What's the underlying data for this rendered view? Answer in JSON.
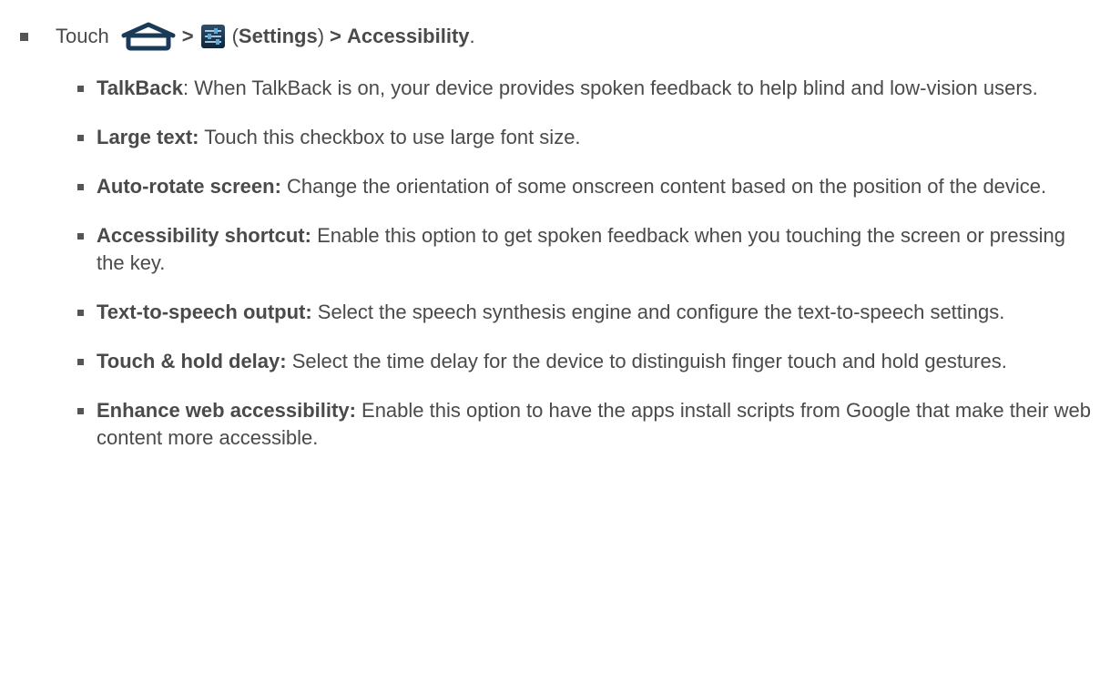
{
  "step": {
    "touch": "Touch",
    "gt1": ">",
    "paren_open": "(",
    "settings": "Settings",
    "paren_close": ")",
    "gt2": "> ",
    "accessibility": "Accessibility",
    "period": ".",
    "icons": [
      "home-icon",
      "settings-icon"
    ]
  },
  "items": [
    {
      "term": "TalkBack",
      "desc": ": When TalkBack is on, your device provides spoken feedback to help blind and low-vision users."
    },
    {
      "term": "Large text:",
      "desc": " Touch this checkbox to use large font size."
    },
    {
      "term": "Auto-rotate screen:",
      "desc": " Change the orientation of some onscreen content based on the position of the device."
    },
    {
      "term": "Accessibility shortcut:",
      "desc": " Enable this option to get spoken feedback when you touching the screen or pressing the key."
    },
    {
      "term": "Text-to-speech output:",
      "desc": " Select the speech synthesis engine and configure the text-to-speech settings."
    },
    {
      "term": "Touch & hold delay:",
      "desc": " Select the time delay for the device to distinguish finger touch and hold gestures."
    },
    {
      "term": "Enhance web accessibility:",
      "desc": " Enable this option to have the apps install scripts from Google that make their web content more accessible."
    }
  ],
  "colors": {
    "text": "#4a4a4a",
    "bullet": "#555555",
    "icon_dark": "#1b3a57",
    "icon_accent": "#5aa9d9"
  }
}
